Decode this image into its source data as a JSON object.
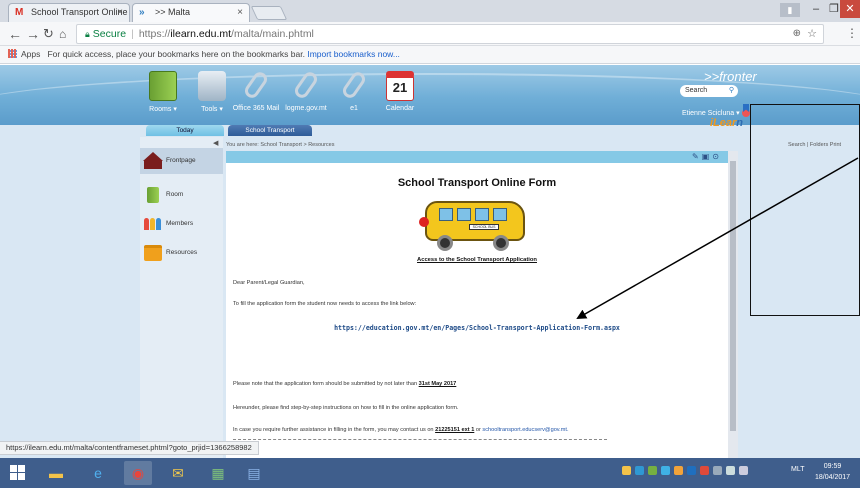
{
  "browser": {
    "tabs": [
      {
        "title": "School Transport Online",
        "icon": "gmail-icon"
      },
      {
        "title": ">> Malta",
        "icon": "fronter-icon",
        "active": true
      }
    ],
    "omnibox": {
      "secure_label": "Secure",
      "protocol": "https://",
      "host": "ilearn.edu.mt",
      "path": "/malta/main.phtml"
    },
    "bookmarks": {
      "apps_label": "Apps",
      "hint": "For quick access, place your bookmarks here on the bookmarks bar.",
      "import_link": "Import bookmarks now..."
    },
    "status_url": "https://ilearn.edu.mt/malta/contentframeset.phtml?goto_prjid=1366258982"
  },
  "fronter": {
    "logo": ">>fronter",
    "search_label": "Search",
    "user_name": "Etienne Scicluna",
    "ilearn_logo_i": "iLear",
    "ilearn_logo_n": "n",
    "toolbar": [
      {
        "label": "Rooms",
        "icon": "door-icon",
        "dropdown": true
      },
      {
        "label": "Tools",
        "icon": "tools-icon",
        "dropdown": true
      },
      {
        "label": "Office 365 Mail",
        "icon": "link-icon"
      },
      {
        "label": "logme.gov.mt",
        "icon": "link-icon"
      },
      {
        "label": "e1",
        "icon": "link-icon"
      },
      {
        "label": "Calendar",
        "icon": "calendar-icon",
        "day": "21"
      }
    ],
    "tabs": [
      {
        "label": "Today"
      },
      {
        "label": "School Transport",
        "active": true
      }
    ],
    "breadcrumb": "You are here: School Transport > Resources",
    "right_links": "Search | Folders Print",
    "nav": [
      {
        "label": "Frontpage",
        "icon": "home-icon",
        "active": true
      },
      {
        "label": "Room",
        "icon": "room-icon"
      },
      {
        "label": "Members",
        "icon": "members-icon"
      },
      {
        "label": "Resources",
        "icon": "folder-icon"
      }
    ]
  },
  "document": {
    "title": "School Transport Online Form",
    "bus_sign": "SCHOOL BUS",
    "access_heading": "Access to the School Transport Application",
    "greeting": "Dear Parent/Legal Guardian,",
    "intro": "To fill the application form the student now needs to access the link below:",
    "form_url": "https://education.gov.mt/en/Pages/School-Transport-Application-Form.aspx",
    "deadline_text": "Please note that the application form should be submitted by not later than ",
    "deadline_date": "31st May 2017",
    "instructions": "Hereunder, please find step-by-step instructions on how to fill in the online application form.",
    "contact_prefix": "In case you require further assistance in filling in the form, you may contact us on ",
    "contact_phone": "21225151 ext 1",
    "contact_mid": " or ",
    "contact_email": "schooltransport.educserv@gov.mt."
  },
  "taskbar": {
    "lang": "MLT",
    "time": "09:59",
    "date": "18/04/2017"
  }
}
